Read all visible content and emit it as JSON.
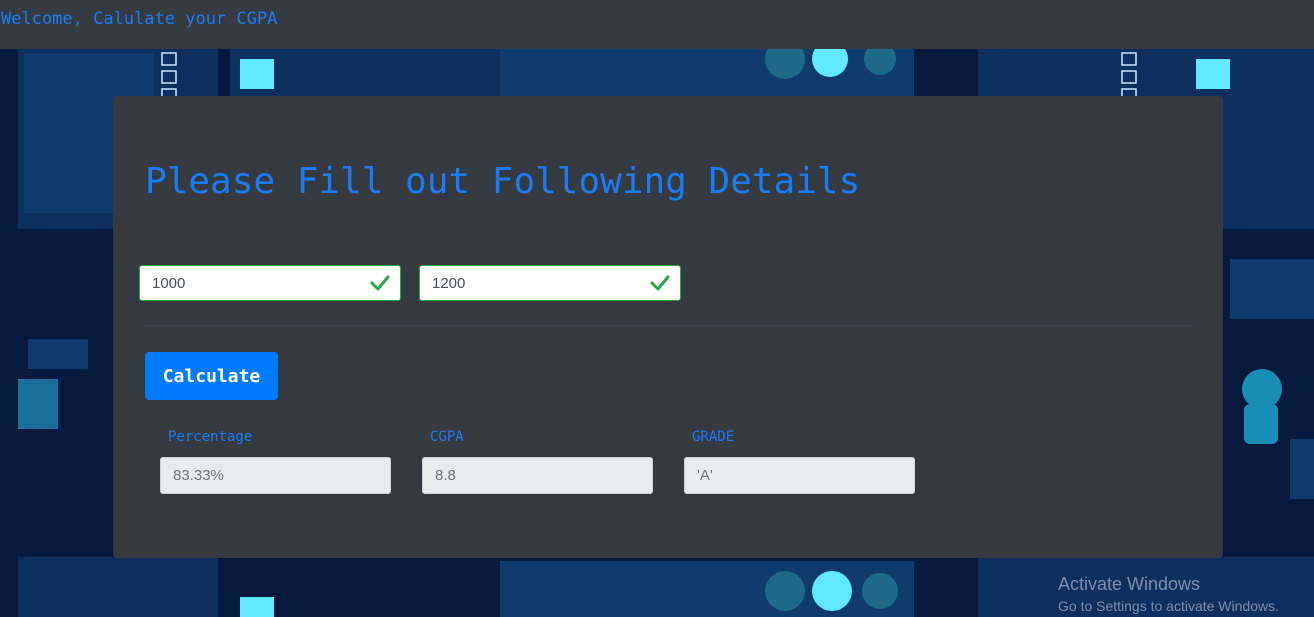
{
  "navbar": {
    "title": "Welcome, Calulate your CGPA"
  },
  "form": {
    "heading": "Please Fill out Following Details",
    "obtained_marks": {
      "value": "1000"
    },
    "total_marks": {
      "value": "1200"
    },
    "calculate_label": "Calculate"
  },
  "results": {
    "percentage": {
      "label": "Percentage",
      "value": "83.33%"
    },
    "cgpa": {
      "label": "CGPA",
      "value": "8.8"
    },
    "grade": {
      "label": "GRADE",
      "value": "'A'"
    }
  },
  "watermark": {
    "title": "Activate Windows",
    "subtitle": "Go to Settings to activate Windows."
  },
  "colors": {
    "accent": "#1a7cf5",
    "card": "#343a40",
    "button": "#007bff",
    "valid": "#28a745",
    "background": "#061a3e"
  }
}
